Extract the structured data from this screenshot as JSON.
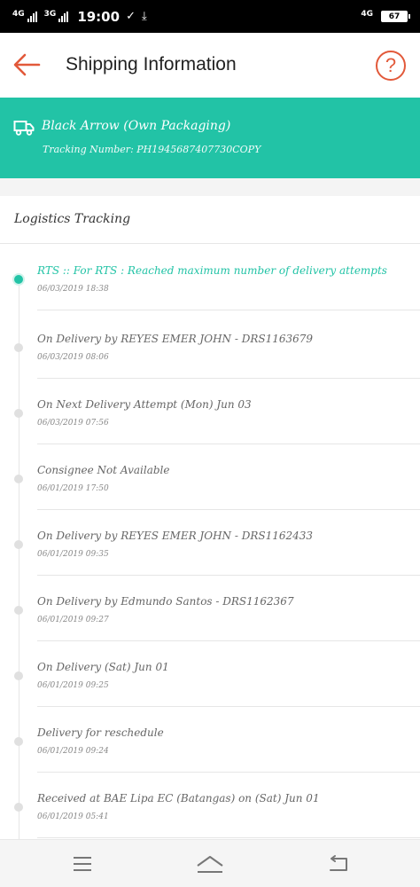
{
  "status_bar": {
    "signal_1": "4G",
    "signal_2": "3G",
    "time": "19:00",
    "signal_3": "4G",
    "battery": "67"
  },
  "header": {
    "title": "Shipping Information"
  },
  "shipment": {
    "carrier": "Black Arrow (Own Packaging)",
    "tracking_number": "Tracking Number: PH1945687407730COPY"
  },
  "section": {
    "title": "Logistics Tracking"
  },
  "events": [
    {
      "status": "RTS :: For RTS : Reached maximum number of delivery attempts",
      "date": "06/03/2019 18:38"
    },
    {
      "status": "On Delivery by REYES EMER JOHN - DRS1163679",
      "date": "06/03/2019 08:06"
    },
    {
      "status": "On Next Delivery Attempt (Mon) Jun 03",
      "date": "06/03/2019 07:56"
    },
    {
      "status": "Consignee Not Available",
      "date": "06/01/2019 17:50"
    },
    {
      "status": "On Delivery by REYES EMER JOHN - DRS1162433",
      "date": "06/01/2019 09:35"
    },
    {
      "status": "On Delivery by Edmundo Santos - DRS1162367",
      "date": "06/01/2019 09:27"
    },
    {
      "status": "On Delivery (Sat) Jun 01",
      "date": "06/01/2019 09:25"
    },
    {
      "status": "Delivery for reschedule",
      "date": "06/01/2019 09:24"
    },
    {
      "status": "Received at BAE Lipa EC (Batangas) on (Sat) Jun 01",
      "date": "06/01/2019 05:41"
    }
  ],
  "colors": {
    "accent": "#22c3a6",
    "back_arrow": "#e2593a",
    "help": "#e2593a"
  },
  "icons": [
    "back-arrow-icon",
    "help-icon",
    "truck-icon",
    "menu-icon",
    "home-icon",
    "back-icon"
  ]
}
